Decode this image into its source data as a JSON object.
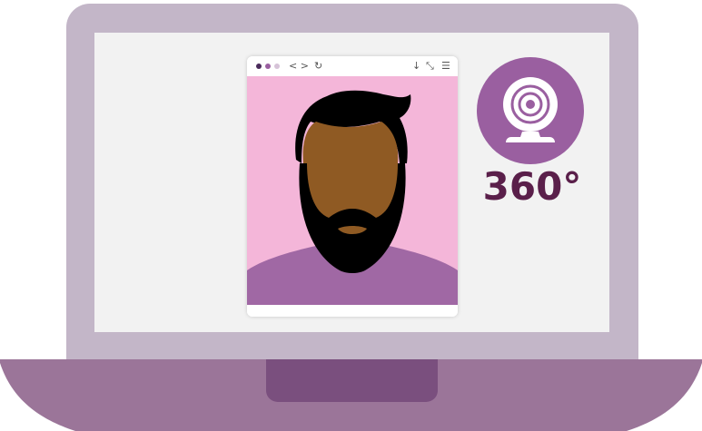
{
  "browser": {
    "toolbar": {
      "back_forward_icon": "chevron-left-right-icon",
      "reload_icon": "reload-icon",
      "download_icon": "download-icon",
      "expand_icon": "expand-icon",
      "menu_icon": "hamburger-menu-icon",
      "back_forward_glyph": "< >",
      "reload_glyph": "↻",
      "download_glyph": "↓",
      "expand_glyph": "⤡",
      "menu_glyph": "☰"
    },
    "content": {
      "avatar_icon": "bearded-man-avatar-icon"
    }
  },
  "badge": {
    "icon": "webcam-icon",
    "label": "360°"
  },
  "colors": {
    "laptop_lid": "#c3b6c8",
    "laptop_base": "#9b7599",
    "laptop_notch": "#7a4f7e",
    "screen": "#f2f2f2",
    "browser_bg": "#f4b6d9",
    "skin": "#8f5a23",
    "hair": "#000000",
    "shirt": "#a068a4",
    "badge_circle": "#9a5fa0",
    "badge_text": "#5a1f4a"
  }
}
